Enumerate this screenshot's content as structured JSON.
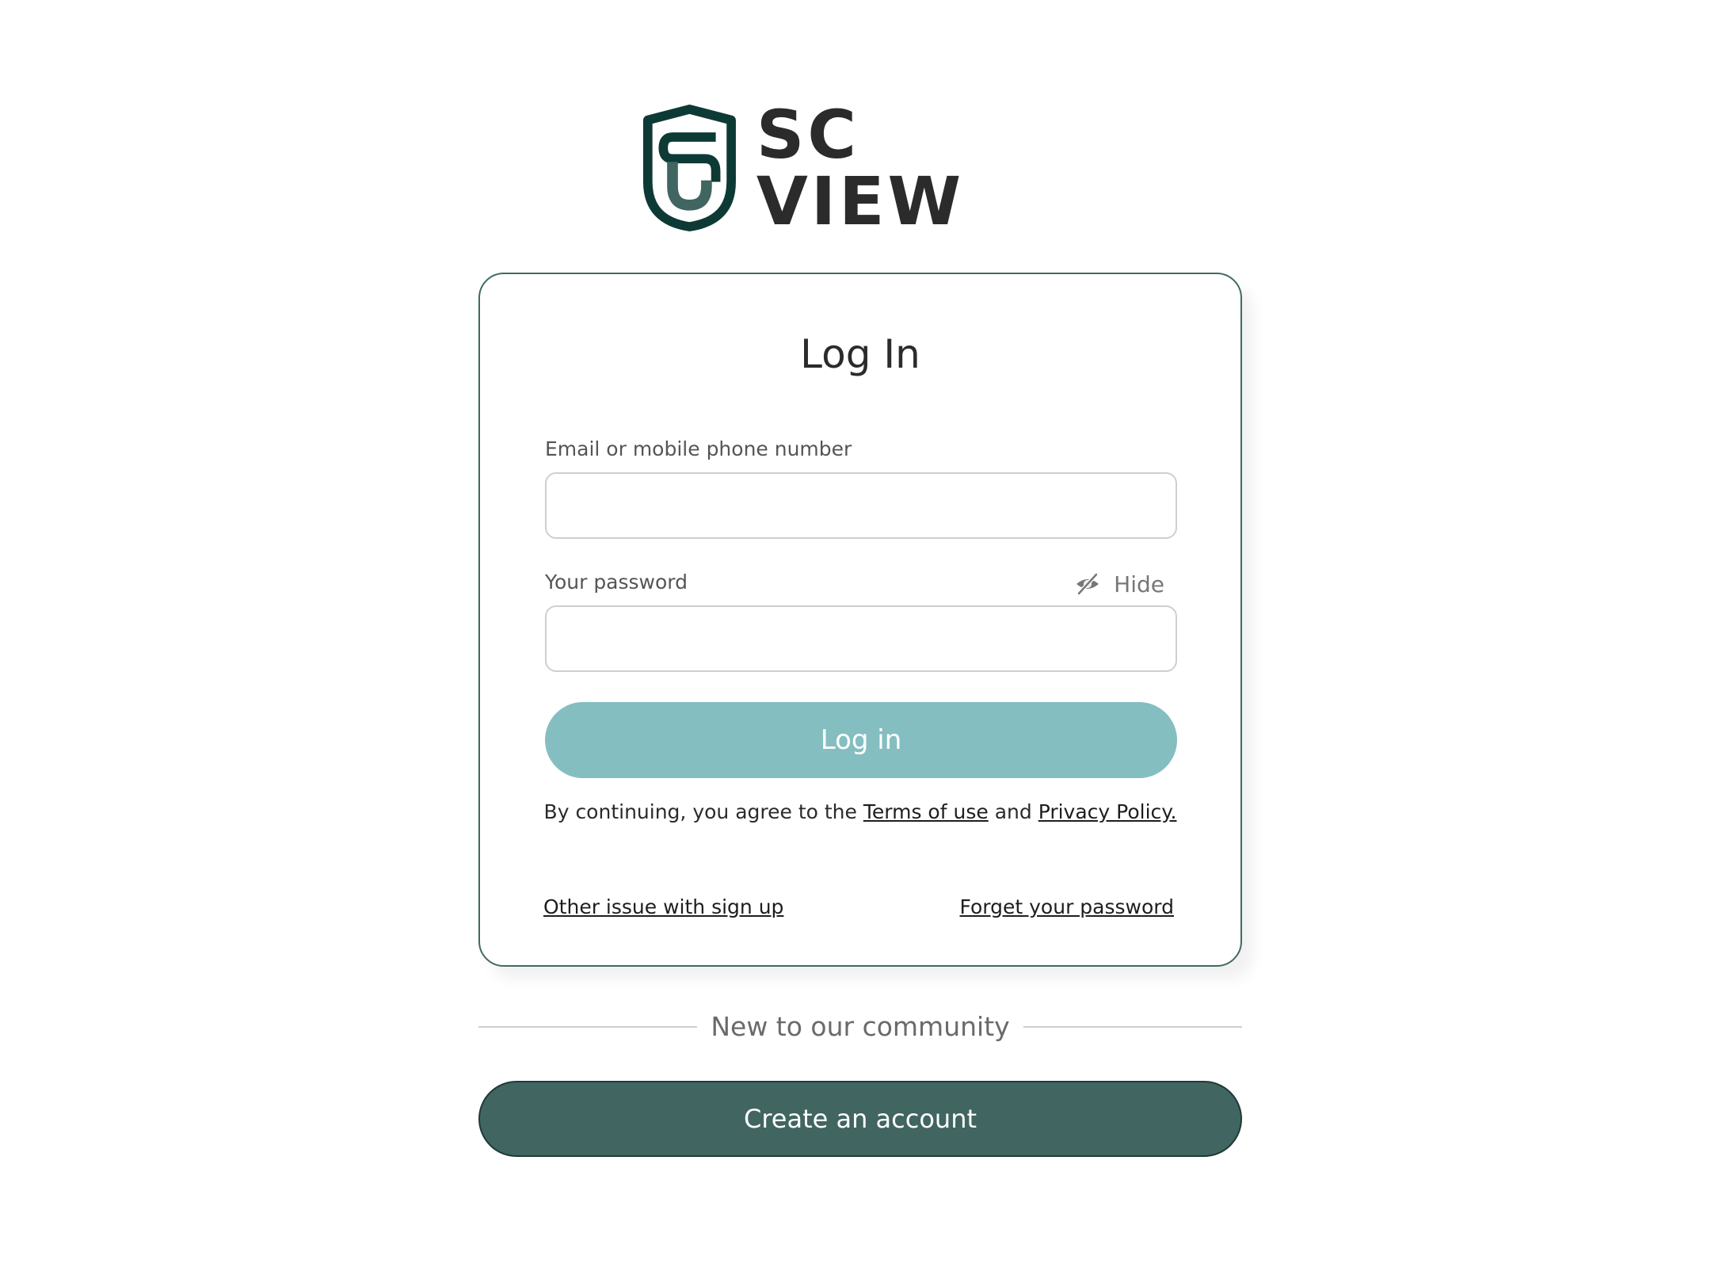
{
  "brand": {
    "name": "SC VIEW",
    "logo_icon": "shield-s-icon",
    "colors": {
      "dark": "#0d3a35",
      "mid": "#416561"
    }
  },
  "login": {
    "title": "Log In",
    "email": {
      "label": "Email or mobile phone number",
      "value": "",
      "placeholder": ""
    },
    "password": {
      "label": "Your password",
      "value": "",
      "placeholder": "",
      "toggle_label": "Hide",
      "toggle_icon": "eye-slash-icon"
    },
    "submit_label": "Log in",
    "submit_color": "#85bec1",
    "terms": {
      "prefix": "By continuing, you agree to the",
      "terms_link": "Terms of use",
      "conjunction": "and",
      "privacy_link": "Privacy Policy."
    },
    "links": {
      "other_issue": "Other issue with sign up",
      "forget_password": "Forget your password"
    }
  },
  "signup": {
    "divider_text": "New to our community",
    "create_label": "Create an account",
    "create_color": "#416561"
  }
}
